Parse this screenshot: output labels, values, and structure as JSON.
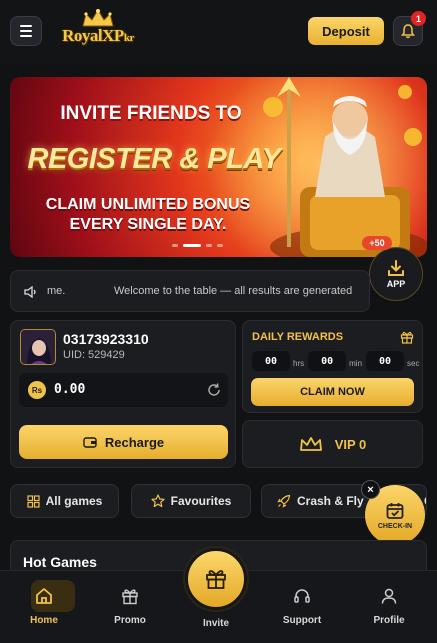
{
  "header": {
    "logo_text": "RoyalXP",
    "logo_sub": "kr",
    "deposit_label": "Deposit",
    "notification_count": "1"
  },
  "banner": {
    "line1": "INVITE FRIENDS TO",
    "line2": "REGISTER & PLAY",
    "line3a": "CLAIM UNLIMITED BONUS",
    "line3b": "EVERY SINGLE DAY."
  },
  "app": {
    "label": "APP",
    "bonus": "+50"
  },
  "marquee": {
    "left_text": "me.",
    "main_text": "Welcome to the table — all results are generated"
  },
  "user": {
    "phone": "03173923310",
    "uid": "UID: 529429",
    "currency_symbol": "Rs",
    "balance": "0.00",
    "recharge_label": "Recharge"
  },
  "daily_rewards": {
    "title": "DAILY REWARDS",
    "hours": "00",
    "hours_unit": "hrs",
    "minutes": "00",
    "minutes_unit": "min",
    "seconds": "00",
    "seconds_unit": "sec",
    "claim_label": "CLAIM NOW"
  },
  "vip": {
    "label": "VIP 0"
  },
  "categories": [
    "All games",
    "Favourites",
    "Crash & Fly",
    "C"
  ],
  "checkin": {
    "label": "CHECK-IN"
  },
  "hot_games": {
    "title": "Hot Games"
  },
  "nav": {
    "home": "Home",
    "promo": "Promo",
    "invite": "Invite",
    "support": "Support",
    "profile": "Profile"
  },
  "colors": {
    "accent": "#f2c14c",
    "background": "#111214",
    "card": "#1c1d21"
  }
}
